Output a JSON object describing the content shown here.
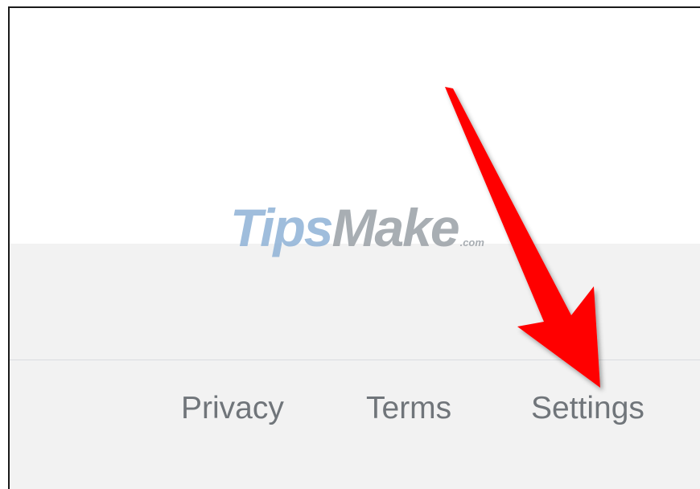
{
  "footer": {
    "links": [
      {
        "label": "Privacy"
      },
      {
        "label": "Terms"
      },
      {
        "label": "Settings"
      }
    ]
  },
  "watermark": {
    "part1": "Tips",
    "part2": "Make",
    "part3": ".com"
  },
  "colors": {
    "footer_bg": "#f2f2f2",
    "footer_link": "#70757a",
    "divider": "#dadce0",
    "arrow": "#ff0000"
  },
  "annotation": {
    "icon": "red-arrow-icon"
  }
}
